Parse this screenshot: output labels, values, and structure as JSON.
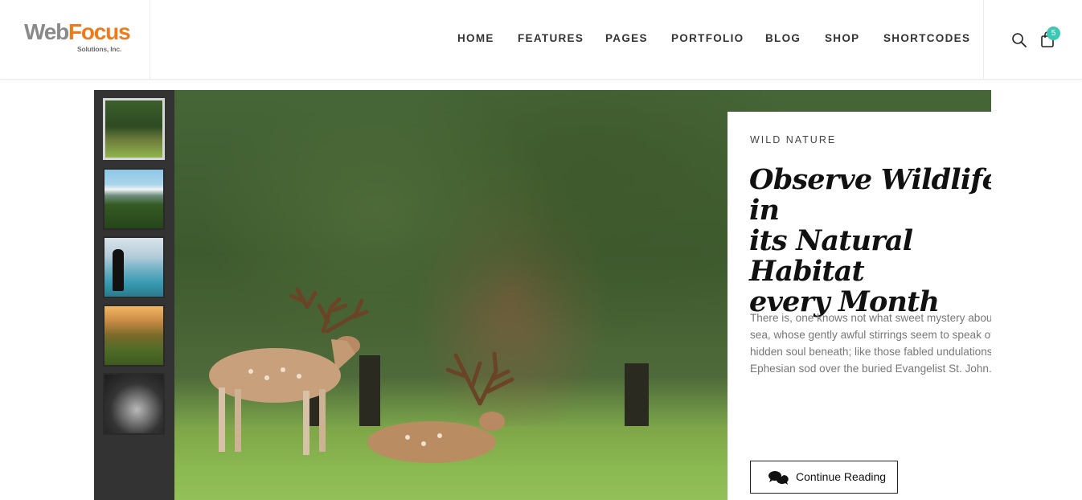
{
  "brand": {
    "name_part1": "Web",
    "name_part2": "Focus",
    "tagline": "Solutions, Inc."
  },
  "nav": {
    "items": [
      {
        "label": "HOME"
      },
      {
        "label": "FEATURES"
      },
      {
        "label": "PAGES"
      },
      {
        "label": "PORTFOLIO"
      },
      {
        "label": "BLOG"
      },
      {
        "label": "SHOP"
      },
      {
        "label": "SHORTCODES"
      }
    ]
  },
  "utility": {
    "search_icon": "search-icon",
    "cart_icon": "shopping-bag-icon",
    "cart_count": "5"
  },
  "slider": {
    "thumbnails": [
      {
        "name": "deer-in-forest",
        "active": true
      },
      {
        "name": "mountain-valley"
      },
      {
        "name": "person-by-lake"
      },
      {
        "name": "autumn-landscape"
      },
      {
        "name": "rocky-stream"
      }
    ],
    "card": {
      "eyebrow": "WILD NATURE",
      "title_line1": "Observe Wildlife in",
      "title_line2": "its Natural Habitat",
      "title_line3": "every Month",
      "body": "There is, one knows not what sweet mystery about this sea, whose gently awful stirrings seem to speak of some hidden soul beneath; like those fabled undulations of the Ephesian sod over the buried Evangelist St. John.",
      "button_label": "Continue Reading",
      "button_icon": "chat-bubbles-icon"
    }
  },
  "colors": {
    "accent_orange": "#ef7a1a",
    "badge_teal": "#3cc8b4",
    "thumb_rail": "#333333"
  }
}
